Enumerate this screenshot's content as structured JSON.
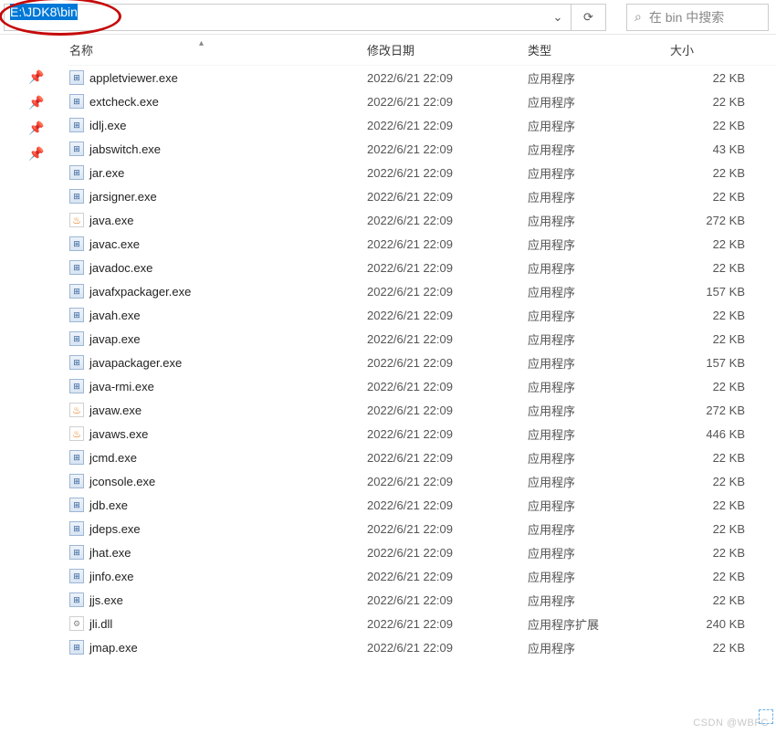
{
  "address": {
    "path": "E:\\JDK8\\bin"
  },
  "refresh_glyph": "⟳",
  "drop_glyph": "⌄",
  "search": {
    "placeholder": "在 bin 中搜索",
    "icon": "⌕"
  },
  "pin_glyph": "📌",
  "sort_indicator": "▴",
  "headers": {
    "name": "名称",
    "date": "修改日期",
    "type": "类型",
    "size": "大小"
  },
  "files": [
    {
      "name": "appletviewer.exe",
      "date": "2022/6/21 22:09",
      "type": "应用程序",
      "size": "22 KB",
      "icon": "exe"
    },
    {
      "name": "extcheck.exe",
      "date": "2022/6/21 22:09",
      "type": "应用程序",
      "size": "22 KB",
      "icon": "exe"
    },
    {
      "name": "idlj.exe",
      "date": "2022/6/21 22:09",
      "type": "应用程序",
      "size": "22 KB",
      "icon": "exe"
    },
    {
      "name": "jabswitch.exe",
      "date": "2022/6/21 22:09",
      "type": "应用程序",
      "size": "43 KB",
      "icon": "exe"
    },
    {
      "name": "jar.exe",
      "date": "2022/6/21 22:09",
      "type": "应用程序",
      "size": "22 KB",
      "icon": "exe"
    },
    {
      "name": "jarsigner.exe",
      "date": "2022/6/21 22:09",
      "type": "应用程序",
      "size": "22 KB",
      "icon": "exe"
    },
    {
      "name": "java.exe",
      "date": "2022/6/21 22:09",
      "type": "应用程序",
      "size": "272 KB",
      "icon": "java"
    },
    {
      "name": "javac.exe",
      "date": "2022/6/21 22:09",
      "type": "应用程序",
      "size": "22 KB",
      "icon": "exe"
    },
    {
      "name": "javadoc.exe",
      "date": "2022/6/21 22:09",
      "type": "应用程序",
      "size": "22 KB",
      "icon": "exe"
    },
    {
      "name": "javafxpackager.exe",
      "date": "2022/6/21 22:09",
      "type": "应用程序",
      "size": "157 KB",
      "icon": "exe"
    },
    {
      "name": "javah.exe",
      "date": "2022/6/21 22:09",
      "type": "应用程序",
      "size": "22 KB",
      "icon": "exe"
    },
    {
      "name": "javap.exe",
      "date": "2022/6/21 22:09",
      "type": "应用程序",
      "size": "22 KB",
      "icon": "exe"
    },
    {
      "name": "javapackager.exe",
      "date": "2022/6/21 22:09",
      "type": "应用程序",
      "size": "157 KB",
      "icon": "exe"
    },
    {
      "name": "java-rmi.exe",
      "date": "2022/6/21 22:09",
      "type": "应用程序",
      "size": "22 KB",
      "icon": "exe"
    },
    {
      "name": "javaw.exe",
      "date": "2022/6/21 22:09",
      "type": "应用程序",
      "size": "272 KB",
      "icon": "java"
    },
    {
      "name": "javaws.exe",
      "date": "2022/6/21 22:09",
      "type": "应用程序",
      "size": "446 KB",
      "icon": "java"
    },
    {
      "name": "jcmd.exe",
      "date": "2022/6/21 22:09",
      "type": "应用程序",
      "size": "22 KB",
      "icon": "exe"
    },
    {
      "name": "jconsole.exe",
      "date": "2022/6/21 22:09",
      "type": "应用程序",
      "size": "22 KB",
      "icon": "exe"
    },
    {
      "name": "jdb.exe",
      "date": "2022/6/21 22:09",
      "type": "应用程序",
      "size": "22 KB",
      "icon": "exe"
    },
    {
      "name": "jdeps.exe",
      "date": "2022/6/21 22:09",
      "type": "应用程序",
      "size": "22 KB",
      "icon": "exe"
    },
    {
      "name": "jhat.exe",
      "date": "2022/6/21 22:09",
      "type": "应用程序",
      "size": "22 KB",
      "icon": "exe"
    },
    {
      "name": "jinfo.exe",
      "date": "2022/6/21 22:09",
      "type": "应用程序",
      "size": "22 KB",
      "icon": "exe"
    },
    {
      "name": "jjs.exe",
      "date": "2022/6/21 22:09",
      "type": "应用程序",
      "size": "22 KB",
      "icon": "exe"
    },
    {
      "name": "jli.dll",
      "date": "2022/6/21 22:09",
      "type": "应用程序扩展",
      "size": "240 KB",
      "icon": "dll"
    },
    {
      "name": "jmap.exe",
      "date": "2022/6/21 22:09",
      "type": "应用程序",
      "size": "22 KB",
      "icon": "exe"
    }
  ],
  "watermark": "CSDN @WBFC"
}
